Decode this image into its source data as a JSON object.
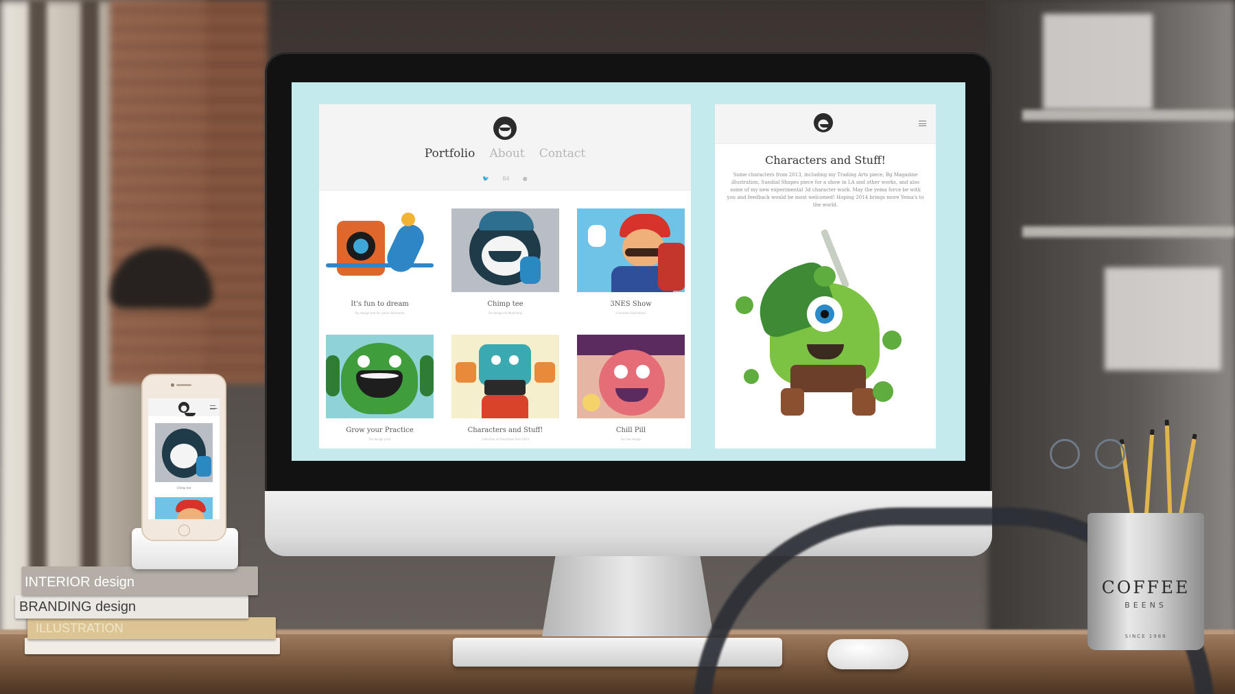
{
  "screen": {
    "portfolio": {
      "nav": [
        "Portfolio",
        "About",
        "Contact"
      ],
      "nav_active": 0,
      "social_icons": [
        "twitter-icon",
        "behance-icon",
        "dribbble-icon"
      ],
      "social_glyphs": [
        "🐦",
        "Bē",
        "●"
      ],
      "cards": [
        {
          "title": "It's fun to dream",
          "subtitle": "Toy design and fun yema illustration"
        },
        {
          "title": "Chimp tee",
          "subtitle": "Tee design for Mailchimp"
        },
        {
          "title": "3NES Show",
          "subtitle": "Character illustrations"
        },
        {
          "title": "Grow your Practice",
          "subtitle": "Tee design print"
        },
        {
          "title": "Characters and Stuff!",
          "subtitle": "Collection of characters from 2013"
        },
        {
          "title": "Chill Pill",
          "subtitle": "Fun tee design"
        }
      ]
    },
    "post": {
      "title": "Characters and Stuff!",
      "body": "Some characters from 2013, including my Trading Arts piece, Bg Magazine illustration, Sundial Shapes piece for a show in LA and other works, and also some of my new experimental 3d character work. May the yema force be with you and feedback would be most welcomed! Hoping 2014 brings more Yema's to the world."
    }
  },
  "phone": {
    "card_title": "Chimp tee"
  },
  "books": {
    "book1": "INTERIOR design",
    "book2": "BRANDING design",
    "book3": "ILLUSTRATION"
  },
  "cup": {
    "brand": "COFFEE",
    "sub": "BEENS",
    "since": "SINCE 1988"
  },
  "colors": {
    "screen_bg": "#c4eaee",
    "panel_header": "#f4f4f4",
    "nav_active": "#3a3a3a",
    "nav_inactive": "#b5b5b5"
  }
}
